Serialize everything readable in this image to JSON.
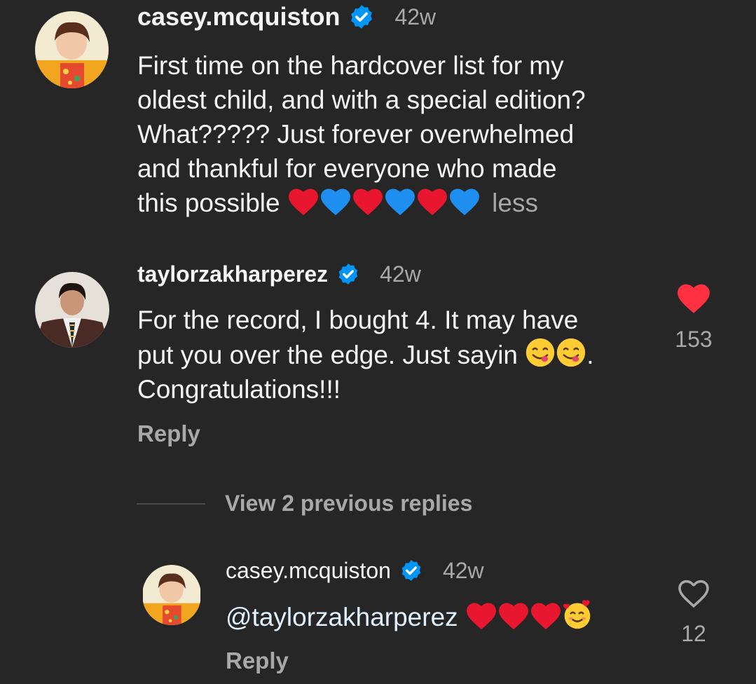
{
  "comments": [
    {
      "username": "casey.mcquiston",
      "time": "42w",
      "text": "First time on the hardcover list for my oldest child, and with a special edition? What????? Just forever overwhelmed and thankful for everyone who made this possible",
      "lines": [
        "First time on the hardcover list for my",
        "oldest child, and with a special edition?",
        "What????? Just forever overwhelmed",
        "and thankful for everyone who made",
        "this possible"
      ],
      "emoji_sequence": [
        "red-heart",
        "blue-heart",
        "red-heart",
        "blue-heart",
        "red-heart",
        "blue-heart"
      ],
      "less_label": "less"
    },
    {
      "username": "taylorzakharperez",
      "time": "42w",
      "lines": [
        "For the record, I bought 4. It may have",
        "put you over the edge. Just sayin",
        "Congratulations!!!"
      ],
      "line2_suffix": ".",
      "emoji_sequence": [
        "yum-face",
        "yum-face"
      ],
      "reply_label": "Reply",
      "like_count": "153",
      "liked": true
    },
    {
      "username": "casey.mcquiston",
      "time": "42w",
      "mention": "@taylorzakharperez",
      "emoji_sequence": [
        "red-heart",
        "red-heart",
        "red-heart",
        "smiling-face-with-hearts"
      ],
      "reply_label": "Reply",
      "like_count": "12",
      "liked": false
    }
  ],
  "view_replies_label": "View 2 previous replies",
  "colors": {
    "background": "#262626",
    "text": "#f5f5f5",
    "secondary": "#a8a8a8",
    "verified": "#0095f6",
    "like_red": "#ff3040",
    "mention": "#e0f1ff"
  }
}
